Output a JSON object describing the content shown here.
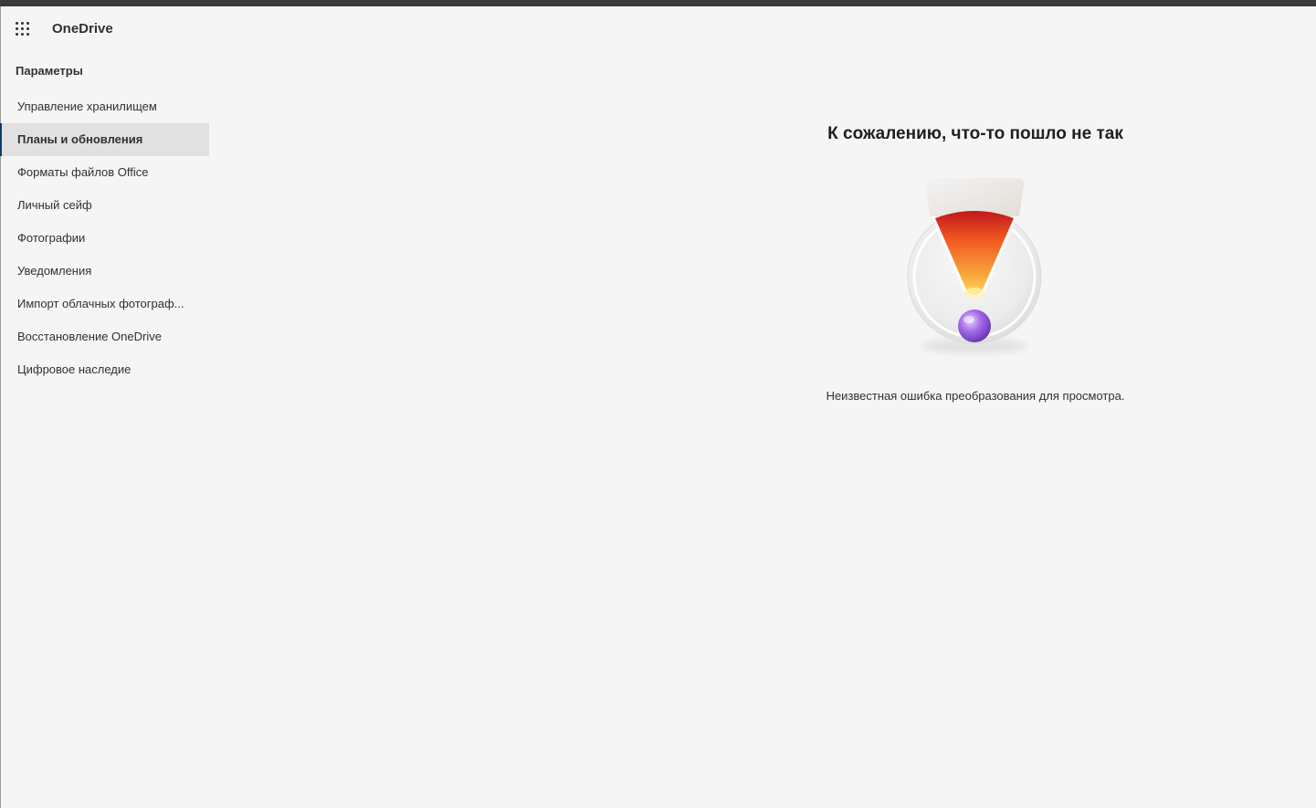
{
  "header": {
    "app_name": "OneDrive"
  },
  "nav": {
    "heading": "Параметры",
    "items": [
      {
        "label": "Управление хранилищем",
        "selected": false
      },
      {
        "label": "Планы и обновления",
        "selected": true
      },
      {
        "label": "Форматы файлов Office",
        "selected": false
      },
      {
        "label": "Личный сейф",
        "selected": false
      },
      {
        "label": "Фотографии",
        "selected": false
      },
      {
        "label": "Уведомления",
        "selected": false
      },
      {
        "label": "Импорт облачных фотограф...",
        "selected": false
      },
      {
        "label": "Восстановление OneDrive",
        "selected": false
      },
      {
        "label": "Цифровое наследие",
        "selected": false
      }
    ]
  },
  "error": {
    "title": "К сожалению, что-то пошло не так",
    "message": "Неизвестная ошибка преобразования для просмотра.",
    "illustration_icon": "exclamation-error-icon"
  },
  "colors": {
    "topbar": "#3b3b3b",
    "background": "#f5f5f5",
    "selected_item_bg": "#e1e1e1",
    "selected_indicator": "#0f3a6b"
  }
}
